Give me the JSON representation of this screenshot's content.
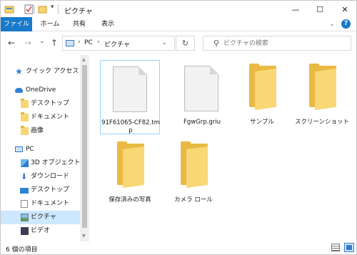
{
  "window": {
    "title": "ピクチャ",
    "controls": {
      "minimize": "—",
      "maximize": "☐",
      "close": "✕"
    }
  },
  "ribbon": {
    "tabs": [
      "ファイル",
      "ホーム",
      "共有",
      "表示"
    ],
    "expand_icon": "chevron-down-icon",
    "help": "?"
  },
  "address_bar": {
    "back": "←",
    "forward": "→",
    "history": "⌄",
    "up": "↑",
    "path": [
      "PC",
      "ピクチャ"
    ],
    "separator": "›",
    "dropdown": "⌄",
    "refresh": "↻"
  },
  "search": {
    "placeholder": "ピクチャの検索"
  },
  "nav_pane": {
    "items": [
      {
        "label": "クイック アクセス",
        "icon": "star-icon"
      },
      {
        "label": "OneDrive",
        "icon": "cloud-icon"
      },
      {
        "label": "デスクトップ",
        "icon": "folder-icon"
      },
      {
        "label": "ドキュメント",
        "icon": "folder-icon"
      },
      {
        "label": "画像",
        "icon": "folder-icon"
      },
      {
        "label": "PC",
        "icon": "pc-icon"
      },
      {
        "label": "3D オブジェクト",
        "icon": "cube-icon"
      },
      {
        "label": "ダウンロード",
        "icon": "download-icon"
      },
      {
        "label": "デスクトップ",
        "icon": "desktop-icon"
      },
      {
        "label": "ドキュメント",
        "icon": "document-icon"
      },
      {
        "label": "ピクチャ",
        "icon": "pictures-icon",
        "selected": true
      },
      {
        "label": "ビデオ",
        "icon": "video-icon"
      }
    ]
  },
  "content": {
    "items": [
      {
        "name": "91F61065-CF82.tmp",
        "type": "file",
        "selected": true
      },
      {
        "name": "FgwGrp.griu",
        "type": "file"
      },
      {
        "name": "サンプル",
        "type": "folder"
      },
      {
        "name": "スクリーンショット",
        "type": "folder"
      },
      {
        "name": "保存済みの写真",
        "type": "folder"
      },
      {
        "name": "カメラ ロール",
        "type": "folder"
      }
    ]
  },
  "status_bar": {
    "item_count": "6 個の項目"
  },
  "colors": {
    "accent": "#1979ca",
    "selection": "#cce8ff",
    "folder": "#f8d775"
  }
}
